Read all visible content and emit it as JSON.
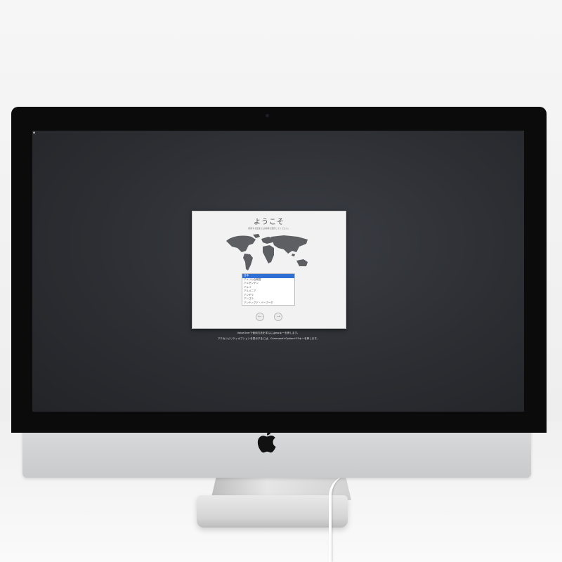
{
  "screen": {
    "menu_apple_icon": "apple-icon"
  },
  "dialog": {
    "title": "ようこそ",
    "subtitle": "使用する国または地域を選択してください。",
    "languages": [
      "日本",
      "アメリカ合衆国",
      "アルゼンチン",
      "アルバ",
      "アルメニア",
      "アンギラ",
      "アンゴラ",
      "アンティグア・バーブーダ"
    ],
    "selected_language": "日本",
    "back_icon": "arrow-left-icon",
    "next_icon": "arrow-right-icon"
  },
  "hints": {
    "line1": "VoiceOverで使用方法を学ぶにはescキーを押します。",
    "line2": "アクセシビリティオプションを表示するには、Command+Option+F5キーを押します。"
  },
  "colors": {
    "screen_bg": "#2c2e33",
    "selection": "#2f6fd6",
    "chin": "#d3d4d6",
    "bezel": "#0b0b0c"
  }
}
